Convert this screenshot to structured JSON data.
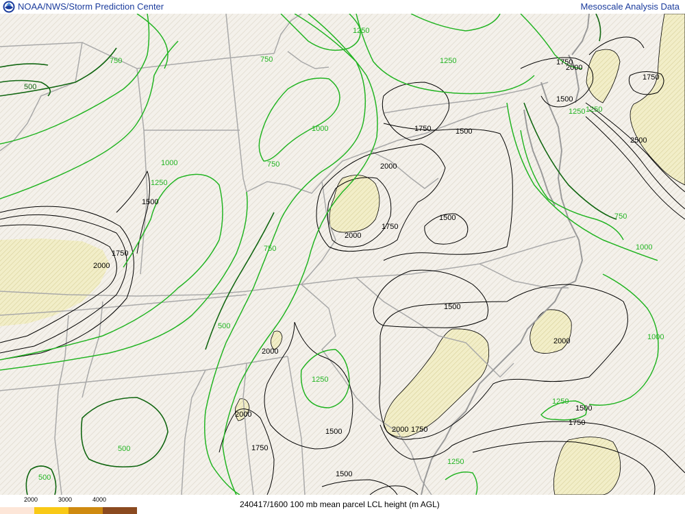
{
  "header": {
    "left_title": "NOAA/NWS/Storm Prediction Center",
    "right_title": "Mesoscale Analysis Data",
    "logo_icon": "noaa-logo"
  },
  "map": {
    "colors": {
      "background": "#f4f1eb",
      "hatch": "#ddd8cc",
      "state_lines": "#a9a9a9",
      "lcl_contours": "#000000",
      "low_lcl_contours": "#22b422",
      "low_lcl_dark": "#116611",
      "shade_fill": "#f0ecc4",
      "shade_hatch": "#d6cf95"
    },
    "contour_labels": [
      {
        "text": "750",
        "color": "green"
      },
      {
        "text": "750",
        "color": "green"
      },
      {
        "text": "500",
        "color": "green"
      },
      {
        "text": "1250",
        "color": "green"
      },
      {
        "text": "1250",
        "color": "green"
      },
      {
        "text": "1750",
        "color": "black"
      },
      {
        "text": "2000",
        "color": "black"
      },
      {
        "text": "1750",
        "color": "black"
      },
      {
        "text": "1500",
        "color": "black"
      },
      {
        "text": "1250",
        "color": "green"
      },
      {
        "text": "1500",
        "color": "black"
      },
      {
        "text": "1750",
        "color": "black"
      },
      {
        "text": "1000",
        "color": "green"
      },
      {
        "text": "2500",
        "color": "black"
      },
      {
        "text": "1000",
        "color": "green"
      },
      {
        "text": "1250",
        "color": "green"
      },
      {
        "text": "1500",
        "color": "black"
      },
      {
        "text": "750",
        "color": "green"
      },
      {
        "text": "2000",
        "color": "black"
      },
      {
        "text": "1750",
        "color": "black"
      },
      {
        "text": "1500",
        "color": "black"
      },
      {
        "text": "2000",
        "color": "black"
      },
      {
        "text": "750",
        "color": "green"
      },
      {
        "text": "1750",
        "color": "black"
      },
      {
        "text": "2000",
        "color": "black"
      },
      {
        "text": "1000",
        "color": "green"
      },
      {
        "text": "1250",
        "color": "green"
      },
      {
        "text": "1500",
        "color": "black"
      },
      {
        "text": "750",
        "color": "green"
      },
      {
        "text": "1000",
        "color": "green"
      },
      {
        "text": "1500",
        "color": "black"
      },
      {
        "text": "2000",
        "color": "black"
      },
      {
        "text": "500",
        "color": "green"
      },
      {
        "text": "2000",
        "color": "black"
      },
      {
        "text": "1250",
        "color": "green"
      },
      {
        "text": "1000",
        "color": "green"
      },
      {
        "text": "1250",
        "color": "green"
      },
      {
        "text": "1500",
        "color": "black"
      },
      {
        "text": "2000",
        "color": "black"
      },
      {
        "text": "1500",
        "color": "black"
      },
      {
        "text": "2000",
        "color": "black"
      },
      {
        "text": "1750",
        "color": "black"
      },
      {
        "text": "1750",
        "color": "black"
      },
      {
        "text": "500",
        "color": "green"
      },
      {
        "text": "1750",
        "color": "black"
      },
      {
        "text": "1250",
        "color": "green"
      },
      {
        "text": "500",
        "color": "green"
      },
      {
        "text": "1500",
        "color": "black"
      }
    ]
  },
  "footer": {
    "legend": [
      {
        "label": "2000",
        "color": "#fde6d8"
      },
      {
        "label": "3000",
        "color": "#f9c916"
      },
      {
        "label": "4000",
        "color": "#cf8a10"
      },
      {
        "label": "",
        "color": "#8b4a20"
      }
    ],
    "caption": "240417/1600 100 mb mean parcel LCL height (m AGL)"
  }
}
